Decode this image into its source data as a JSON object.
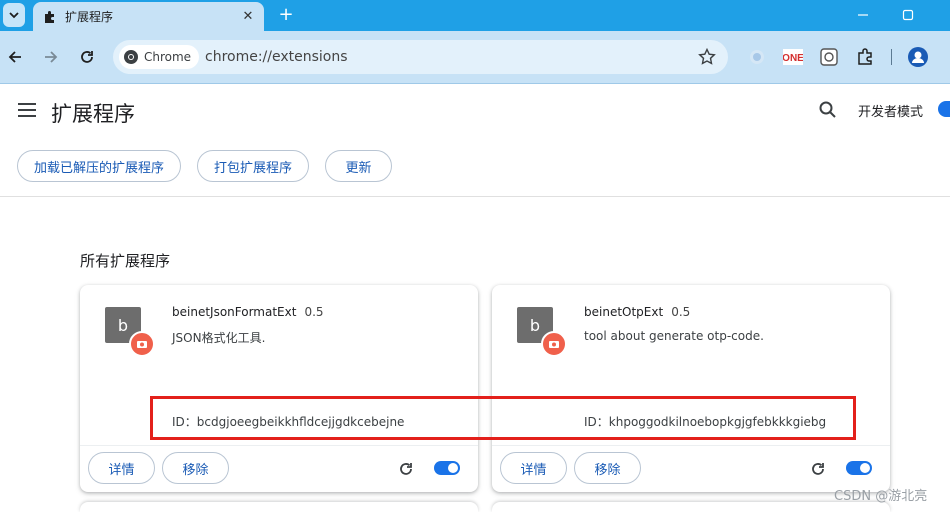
{
  "browser": {
    "tab_title": "扩展程序",
    "omnibox_chip": "Chrome",
    "url": "chrome://extensions",
    "extension_icons": [
      "circle-icon",
      "one-icon",
      "screenshot-icon",
      "puzzle-icon",
      "profile-icon"
    ]
  },
  "header": {
    "title": "扩展程序",
    "dev_mode_label": "开发者模式",
    "buttons": [
      "加载已解压的扩展程序",
      "打包扩展程序",
      "更新"
    ]
  },
  "section": {
    "title": "所有扩展程序"
  },
  "extensions": [
    {
      "icon_letter": "b",
      "name": "beinetJsonFormatExt",
      "version": "0.5",
      "description": "JSON格式化工具.",
      "id_label": "ID：",
      "id": "bcdgjoeegbeikkhfldcejjgdkcebejne",
      "details_label": "详情",
      "remove_label": "移除"
    },
    {
      "icon_letter": "b",
      "name": "beinetOtpExt",
      "version": "0.5",
      "description": "tool about generate otp-code.",
      "id_label": "ID：",
      "id": "khpoggodkilnoebopkgjgfebkkkgiebg",
      "details_label": "详情",
      "remove_label": "移除"
    }
  ],
  "watermark": "CSDN @游北亮",
  "colors": {
    "tabstrip": "#1fa0e6",
    "toolbar": "#c7e2f6",
    "accent": "#1a73e8",
    "highlight": "#e3201b"
  }
}
